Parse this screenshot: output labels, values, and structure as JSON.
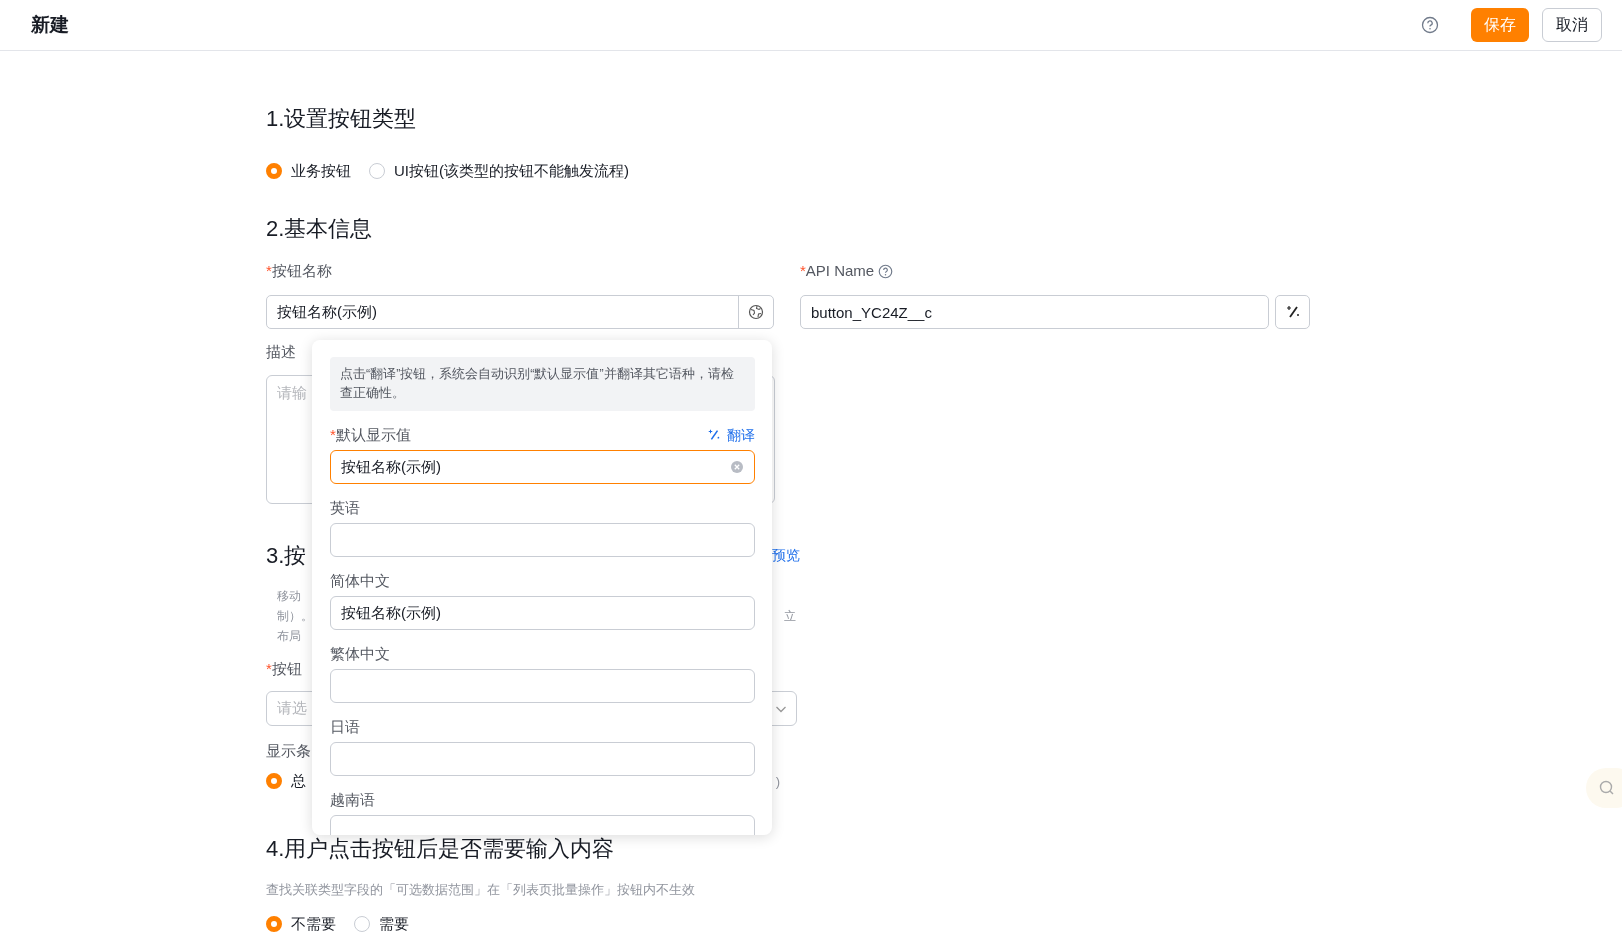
{
  "header": {
    "title": "新建",
    "buttons": [
      {
        "label": "保存",
        "kind": "primary"
      },
      {
        "label": "取消",
        "kind": "default"
      }
    ]
  },
  "section1": {
    "title": "1.设置按钮类型",
    "options": [
      {
        "label": "业务按钮",
        "selected": true
      },
      {
        "label": "UI按钮(该类型的按钮不能触发流程)",
        "selected": false
      }
    ]
  },
  "section2": {
    "title": "2.基本信息",
    "name_mark": "*",
    "name_label": "按钮名称",
    "name_value": "按钮名称(示例)",
    "api_mark": "*",
    "api_label": "API Name",
    "api_value": "button_YC24Z__c",
    "desc_label": "描述",
    "desc_placeholder": "请输"
  },
  "section3": {
    "title": "3.按",
    "preview_link": "预览",
    "desc_lines": [
      {
        "left": "移动"
      },
      {
        "left": "制）。",
        "right": "立"
      },
      {
        "left": "布局"
      }
    ],
    "position_mark": "*",
    "position_label": "按钮",
    "position_placeholder": "请选",
    "condition_label": "显示条",
    "condition_option": {
      "label": "总",
      "selected": true
    },
    "condition_tail": ")"
  },
  "section4": {
    "title": "4.用户点击按钮后是否需要输入内容",
    "note": "查找关联类型字段的「可选数据范围」在「列表页批量操作」按钮内不生效",
    "options": [
      {
        "label": "不需要",
        "selected": true
      },
      {
        "label": "需要",
        "selected": false
      }
    ]
  },
  "popover": {
    "info": "点击“翻译”按钮，系统会自动识别“默认显示值”并翻译其它语种，请检查正确性。",
    "translate_link": "翻译",
    "fields": [
      {
        "mark": "*",
        "label": "默认显示值",
        "value": "按钮名称(示例)",
        "focused": true
      },
      {
        "label": "英语",
        "focused": false
      },
      {
        "label": "简体中文",
        "value": "按钮名称(示例)",
        "focused": false
      },
      {
        "label": "繁体中文",
        "focused": false
      },
      {
        "label": "日语",
        "focused": false
      },
      {
        "label": "越南语",
        "focused": false
      }
    ]
  }
}
